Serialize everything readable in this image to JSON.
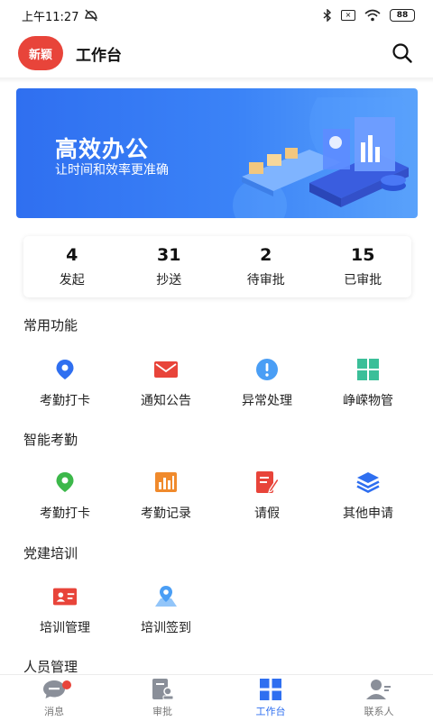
{
  "status_bar": {
    "time": "上午11:27",
    "battery": "88"
  },
  "header": {
    "logo_text": "新颖",
    "title": "工作台"
  },
  "banner": {
    "title": "高效办公",
    "subtitle": "让时间和效率更准确"
  },
  "stats": [
    {
      "value": "4",
      "label": "发起"
    },
    {
      "value": "31",
      "label": "抄送"
    },
    {
      "value": "2",
      "label": "待审批"
    },
    {
      "value": "15",
      "label": "已审批"
    }
  ],
  "sections": {
    "common": {
      "title": "常用功能",
      "items": [
        {
          "label": "考勤打卡",
          "icon": "location-pin-icon",
          "color": "#2f6ff0"
        },
        {
          "label": "通知公告",
          "icon": "mail-icon",
          "color": "#e8443a"
        },
        {
          "label": "异常处理",
          "icon": "alert-icon",
          "color": "#4a9ef5"
        },
        {
          "label": "峥嵘物管",
          "icon": "grid-icon",
          "color": "#3bbf99"
        }
      ]
    },
    "attendance": {
      "title": "智能考勤",
      "items": [
        {
          "label": "考勤打卡",
          "icon": "location-pin-icon",
          "color": "#3cb84a"
        },
        {
          "label": "考勤记录",
          "icon": "bar-chart-icon",
          "color": "#f08a2c"
        },
        {
          "label": "请假",
          "icon": "edit-doc-icon",
          "color": "#e8443a"
        },
        {
          "label": "其他申请",
          "icon": "layers-icon",
          "color": "#2f6ff0"
        }
      ]
    },
    "training": {
      "title": "党建培训",
      "items": [
        {
          "label": "培训管理",
          "icon": "id-card-icon",
          "color": "#e8443a"
        },
        {
          "label": "培训签到",
          "icon": "map-pin-icon",
          "color": "#4a9ef5"
        }
      ]
    },
    "personnel": {
      "title": "人员管理"
    }
  },
  "tabs": [
    {
      "label": "消息",
      "icon": "message-icon"
    },
    {
      "label": "审批",
      "icon": "approval-icon"
    },
    {
      "label": "工作台",
      "icon": "workbench-icon",
      "active": true
    },
    {
      "label": "联系人",
      "icon": "contacts-icon"
    }
  ]
}
